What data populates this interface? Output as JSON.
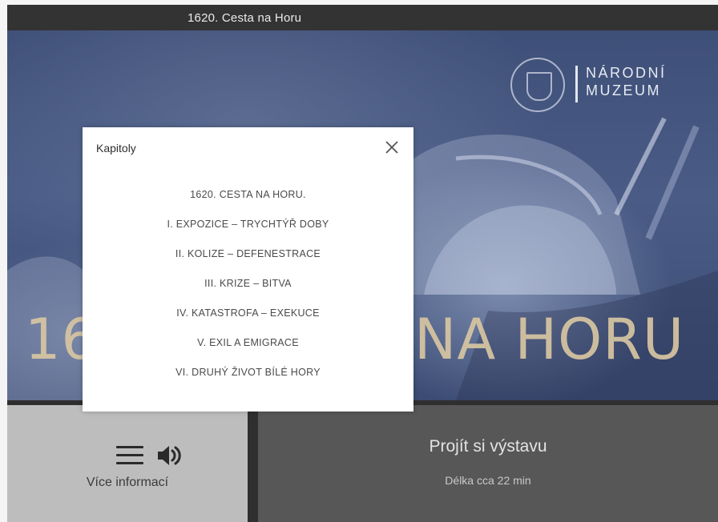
{
  "header": {
    "title": "1620. Cesta na Horu"
  },
  "hero": {
    "title_left": "16",
    "title_right": "NA HORU",
    "logo_line1": "NÁRODNÍ",
    "logo_line2": "MUZEUM"
  },
  "modal": {
    "title": "Kapitoly",
    "close_icon": "close-icon",
    "chapters": [
      "1620. CESTA NA HORU.",
      "I. EXPOZICE – TRYCHTÝŘ DOBY",
      "II. KOLIZE – DEFENESTRACE",
      "III. KRIZE – BITVA",
      "IV. KATASTROFA – EXEKUCE",
      "V. EXIL A EMIGRACE",
      "VI. DRUHÝ ŽIVOT BÍLÉ HORY"
    ]
  },
  "bottom_left": {
    "menu_icon": "hamburger-menu-icon",
    "audio_icon": "speaker-icon",
    "label": "Více informací"
  },
  "bottom_right": {
    "title": "Projít si výstavu",
    "subtitle": "Délka cca 22 min"
  },
  "colors": {
    "hero_blue": "#44557f",
    "title_gold": "#d8c6a2",
    "dark_panel": "#575757",
    "light_panel": "#bdbdbd"
  }
}
